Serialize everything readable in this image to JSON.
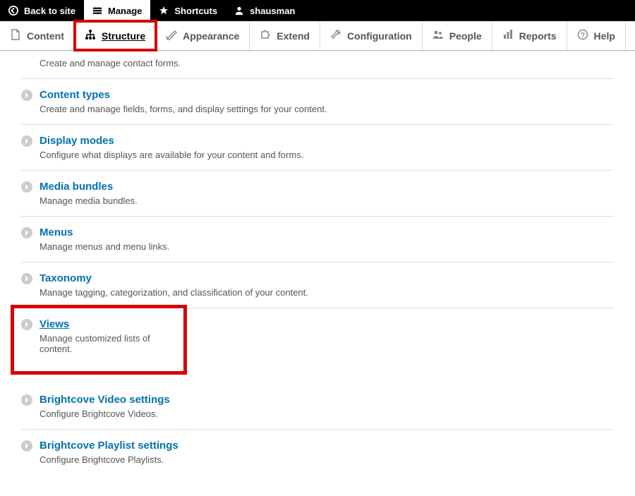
{
  "toolbar": {
    "back": "Back to site",
    "manage": "Manage",
    "shortcuts": "Shortcuts",
    "user": "shausman"
  },
  "tabs": {
    "content": "Content",
    "structure": "Structure",
    "appearance": "Appearance",
    "extend": "Extend",
    "configuration": "Configuration",
    "people": "People",
    "reports": "Reports",
    "help": "Help"
  },
  "items": [
    {
      "title": "",
      "desc": "Create and manage contact forms."
    },
    {
      "title": "Content types",
      "desc": "Create and manage fields, forms, and display settings for your content."
    },
    {
      "title": "Display modes",
      "desc": "Configure what displays are available for your content and forms."
    },
    {
      "title": "Media bundles",
      "desc": "Manage media bundles."
    },
    {
      "title": "Menus",
      "desc": "Manage menus and menu links."
    },
    {
      "title": "Taxonomy",
      "desc": "Manage tagging, categorization, and classification of your content."
    },
    {
      "title": "Views",
      "desc": "Manage customized lists of content."
    },
    {
      "title": "Brightcove Video settings",
      "desc": "Configure Brightcove Videos."
    },
    {
      "title": "Brightcove Playlist settings",
      "desc": "Configure Brightcove Playlists."
    }
  ]
}
